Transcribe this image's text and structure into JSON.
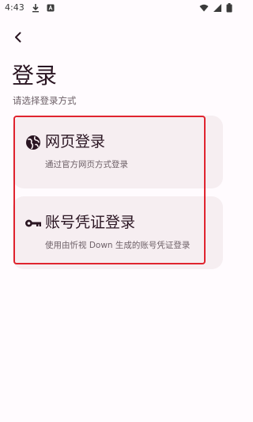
{
  "status_bar": {
    "time": "4:43",
    "left_icons": [
      "download-icon",
      "app-notification-icon"
    ],
    "right_icons": [
      "wifi-icon",
      "signal-icon",
      "battery-icon"
    ]
  },
  "nav": {
    "back_icon": "back-arrow-icon"
  },
  "header": {
    "title": "登录",
    "subtitle": "请选择登录方式"
  },
  "options": [
    {
      "icon": "globe-icon",
      "title": "网页登录",
      "description": "通过官方网页方式登录"
    },
    {
      "icon": "key-icon",
      "title": "账号凭证登录",
      "description": "使用由忻视 Down 生成的账号凭证登录"
    }
  ],
  "colors": {
    "background": "#FFFBFE",
    "card_background": "#F6EEF1",
    "text_primary": "#2A1522",
    "text_secondary": "#6E6168",
    "highlight_border": "#E0242F"
  }
}
